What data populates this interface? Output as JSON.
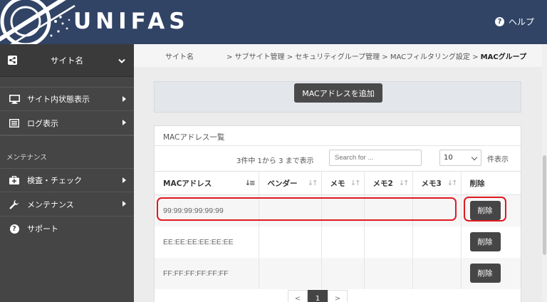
{
  "header": {
    "logo": "UNIFAS",
    "help_label": "ヘルプ"
  },
  "sidebar": {
    "site_name": "サイト名",
    "items": [
      {
        "label": "サイト内状態表示"
      },
      {
        "label": "ログ表示"
      }
    ],
    "section_label": "メンテナンス",
    "maintenance_items": [
      {
        "label": "検査・チェック"
      },
      {
        "label": "メンテナンス"
      },
      {
        "label": "サポート"
      }
    ]
  },
  "breadcrumb": {
    "site": "サイト名",
    "path_prefix": "> サブサイト管理 > セキュリティグループ管理 > MACフィルタリング設定 >",
    "current": "MACグループ"
  },
  "toolbar": {
    "add_label": "MACアドレスを追加"
  },
  "card": {
    "title": "MACアドレス一覧",
    "count_text": "3件中 1から 3 まで表示",
    "search_placeholder": "Search for ...",
    "page_size": "10",
    "per_page_label": "件表示"
  },
  "table": {
    "columns": [
      "MACアドレス",
      "ベンダー",
      "メモ",
      "メモ2",
      "メモ3",
      "削除"
    ],
    "rows": [
      {
        "mac": "99:99:99:99:99:99",
        "vendor": "",
        "memo": "",
        "memo2": "",
        "memo3": "",
        "delete_label": "削除"
      },
      {
        "mac": "EE:EE:EE:EE:EE:EE",
        "vendor": "",
        "memo": "",
        "memo2": "",
        "memo3": "",
        "delete_label": "削除"
      },
      {
        "mac": "FF:FF:FF:FF:FF:FF",
        "vendor": "",
        "memo": "",
        "memo2": "",
        "memo3": "",
        "delete_label": "削除"
      }
    ]
  },
  "pagination": {
    "prev": "<",
    "current": "1",
    "next": ">"
  },
  "colors": {
    "header_bg": "#314466",
    "sidebar_bg": "#454545",
    "highlight": "#e0191f",
    "button_bg": "#464646"
  }
}
